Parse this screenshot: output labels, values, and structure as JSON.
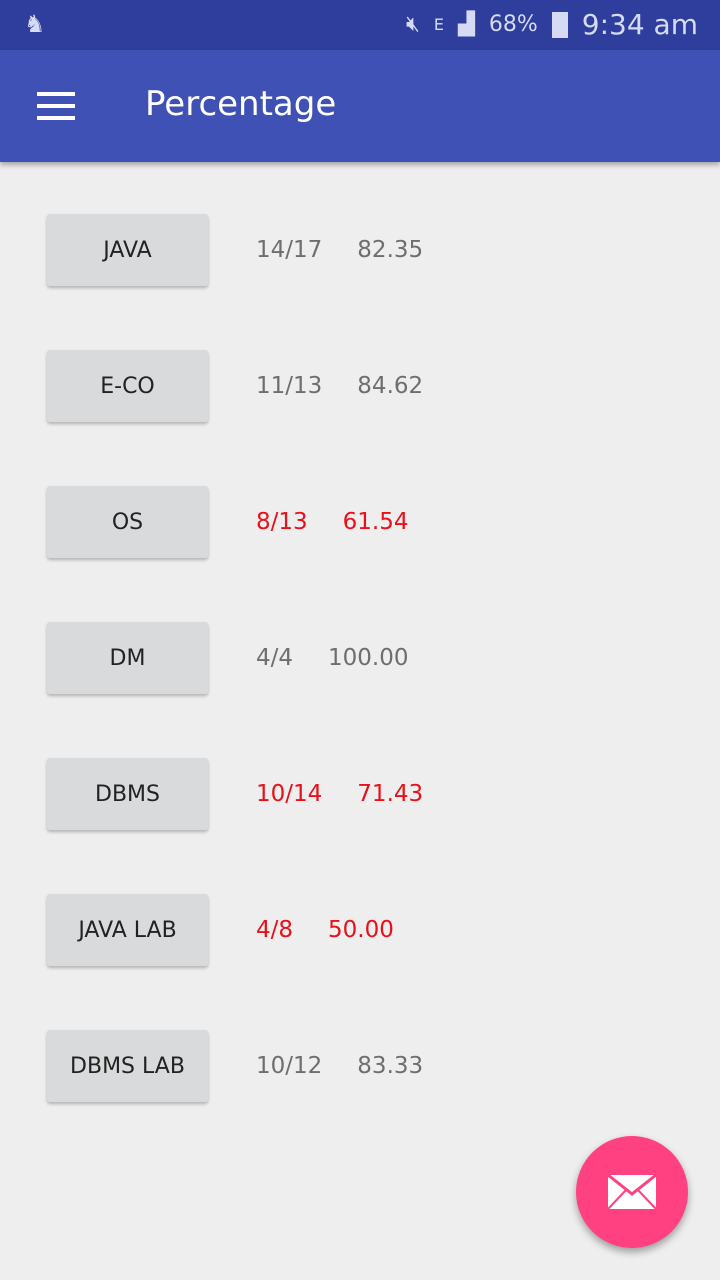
{
  "status_bar": {
    "battery": "68%",
    "time": "9:34 am",
    "network": "E",
    "icons": [
      "notification-figure-icon",
      "mute-icon",
      "data-arrows-icon",
      "signal-icon",
      "battery-icon"
    ]
  },
  "appbar": {
    "title": "Percentage",
    "menu_icon": "hamburger-menu-icon"
  },
  "colors": {
    "primary": "#3f51b5",
    "status_bar": "#2f3d9c",
    "accent": "#ff4081",
    "low": "#e8101a",
    "normal": "#6e6e6e"
  },
  "subjects": [
    {
      "name": "JAVA",
      "attendance": "14/17",
      "percent": "82.35",
      "low": false
    },
    {
      "name": "E-CO",
      "attendance": "11/13",
      "percent": "84.62",
      "low": false
    },
    {
      "name": "OS",
      "attendance": "8/13",
      "percent": "61.54",
      "low": true
    },
    {
      "name": "DM",
      "attendance": "4/4",
      "percent": "100.00",
      "low": false
    },
    {
      "name": "DBMS",
      "attendance": "10/14",
      "percent": "71.43",
      "low": true
    },
    {
      "name": "JAVA LAB",
      "attendance": "4/8",
      "percent": "50.00",
      "low": true
    },
    {
      "name": "DBMS LAB",
      "attendance": "10/12",
      "percent": "83.33",
      "low": false
    }
  ],
  "fab": {
    "icon": "mail-icon"
  }
}
